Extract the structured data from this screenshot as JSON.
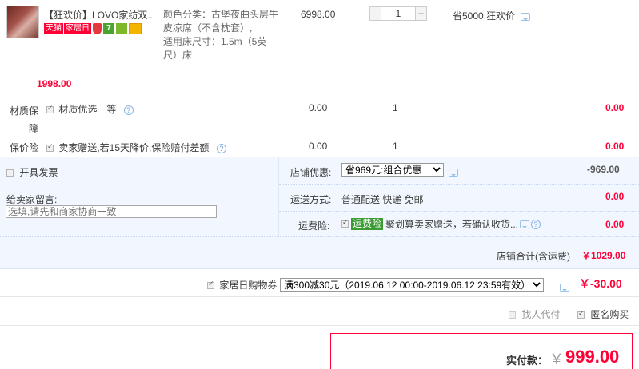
{
  "item": {
    "title": "【狂欢价】LOVO家纺双...",
    "badges": {
      "tmall": "天猫",
      "home": "家居日",
      "shield": "",
      "seven": "7",
      "icon3": "",
      "card": ""
    },
    "sku_line1": "颜色分类：古堡夜曲头层牛",
    "sku_line2": "皮凉席（不含枕套）,",
    "sku_line3": "适用床尺寸：1.5m（5英",
    "sku_line4": "尺）床",
    "unit_price": "6998.00",
    "quantity": "1",
    "qty_minus": "-",
    "qty_plus": "+",
    "promo": "省5000:狂欢价",
    "subtotal": "1998.00"
  },
  "services": [
    {
      "name_line1": "材质保",
      "name_line2": "障",
      "option": "材质优选一等",
      "price": "0.00",
      "qty": "1",
      "total": "0.00"
    },
    {
      "name_line1": "保价险",
      "name_line2": "",
      "option": "卖家赠送,若15天降价,保险赔付差额",
      "price": "0.00",
      "qty": "1",
      "total": "0.00"
    }
  ],
  "invoice": {
    "label": "开具发票"
  },
  "message": {
    "label": "给卖家留言:",
    "placeholder": "选填,请先和商家协商一致"
  },
  "shop_discount": {
    "label": "店铺优惠:",
    "selected": "省969元:组合优惠",
    "amount": "-969.00"
  },
  "shipping": {
    "label": "运送方式:",
    "value": "普通配送 快递 免邮",
    "amount": "0.00"
  },
  "freight_ins": {
    "label": "运费险:",
    "tag": "运费险",
    "text": "聚划算卖家赠送，若确认收货...",
    "amount": "0.00"
  },
  "shop_total": {
    "label": "店铺合计(含运费)",
    "amount": "￥1029.00"
  },
  "coupon": {
    "label": "家居日购物券",
    "selected": "满300减30元（2019.06.12 00:00-2019.06.12 23:59有效）",
    "amount": "￥-30.00"
  },
  "options": {
    "proxy_pay": "找人代付",
    "anonymous": "匿名购买"
  },
  "payment": {
    "label": "实付款：",
    "currency": "￥",
    "amount": "999.00"
  }
}
